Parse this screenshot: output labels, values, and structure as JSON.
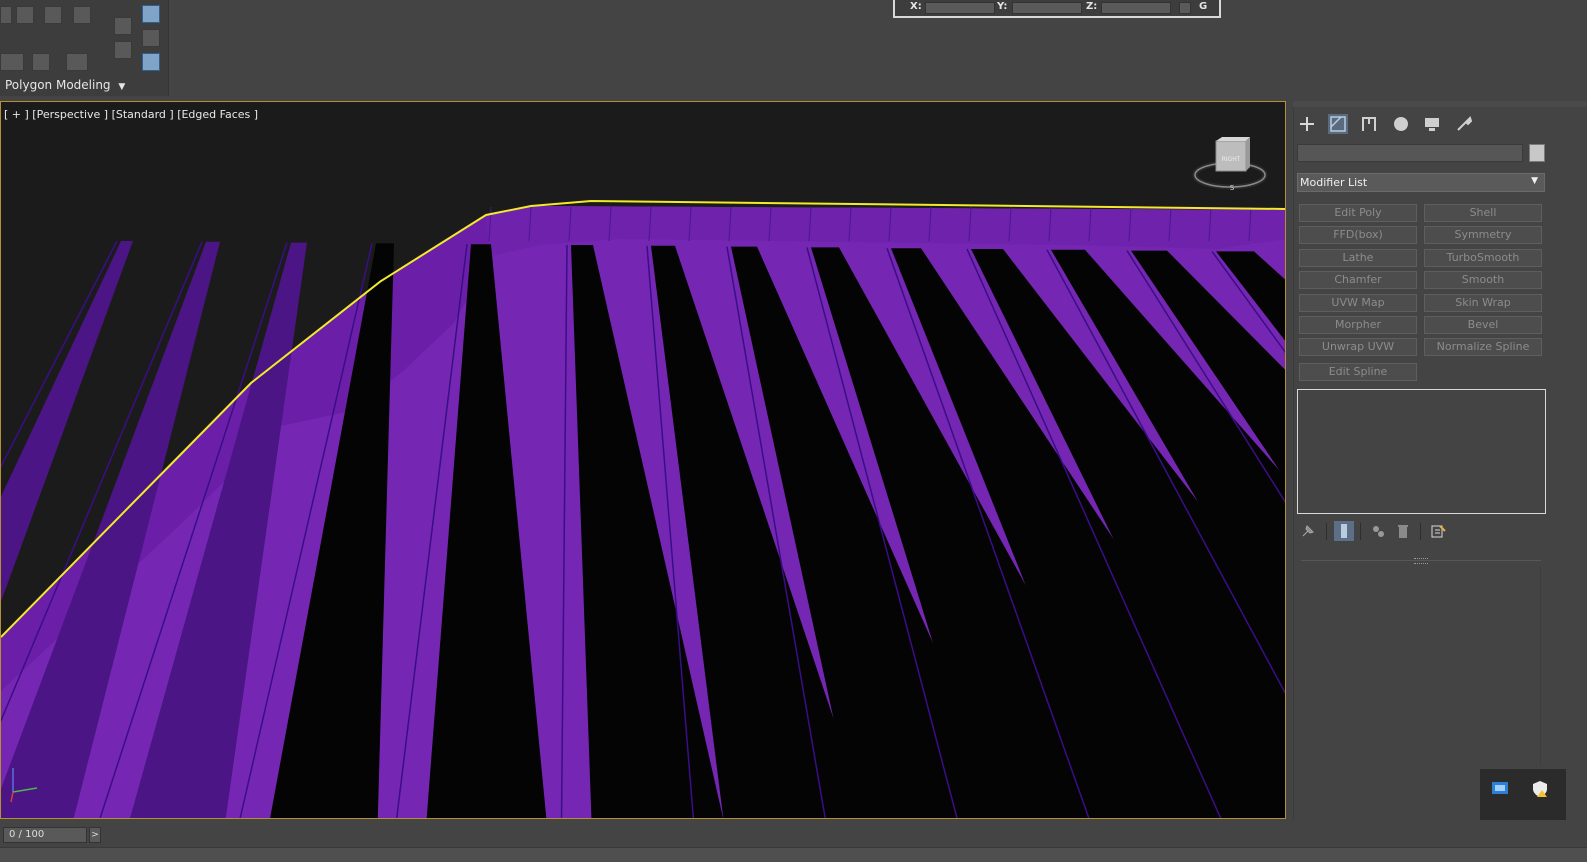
{
  "ribbon": {
    "label": "Polygon Modeling"
  },
  "coords": {
    "x_label": "X:",
    "y_label": "Y:",
    "z_label": "Z:",
    "x": "",
    "y": "",
    "z": "",
    "grid_label": "G"
  },
  "viewport": {
    "label": "[ + ] [Perspective ] [Standard ] [Edged Faces ]"
  },
  "viewcube": {
    "face_label": "RIGHT",
    "compass_label": "S"
  },
  "command_panel": {
    "tabs": [
      "create-icon",
      "modify-icon",
      "hierarchy-icon",
      "motion-icon",
      "display-icon",
      "utilities-icon"
    ],
    "object_name": "",
    "object_color": "#c8c8c8",
    "modifier_list_label": "Modifier List",
    "modifier_buttons": [
      "Edit Poly",
      "Shell",
      "FFD(box)",
      "Symmetry",
      "Lathe",
      "TurboSmooth",
      "Chamfer",
      "Smooth",
      "UVW Map",
      "Skin Wrap",
      "Morpher",
      "Bevel",
      "Unwrap UVW",
      "Normalize Spline",
      "Edit Spline"
    ]
  },
  "timeline": {
    "frame_label": "0 / 100",
    "next_label": ">"
  },
  "colors": {
    "mesh": "#7527b4",
    "mesh_edge": "#3a0e86",
    "highlight": "#f2ea2a",
    "viewport_bg": "#1b1b1b",
    "viewport_border": "#b58f34"
  }
}
